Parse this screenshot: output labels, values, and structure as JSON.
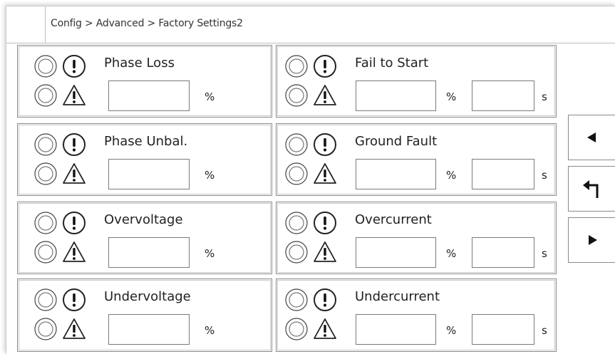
{
  "breadcrumb": "Config > Advanced > Factory Settings2",
  "left_panels": [
    {
      "title": "Phase Loss",
      "unit": "%"
    },
    {
      "title": "Phase Unbal.",
      "unit": "%"
    },
    {
      "title": "Overvoltage",
      "unit": "%"
    },
    {
      "title": "Undervoltage",
      "unit": "%"
    }
  ],
  "right_panels": [
    {
      "title": "Fail to Start",
      "unit1": "%",
      "unit2": "s"
    },
    {
      "title": "Ground Fault",
      "unit1": "%",
      "unit2": "s"
    },
    {
      "title": "Overcurrent",
      "unit1": "%",
      "unit2": "s"
    },
    {
      "title": "Undercurrent",
      "unit1": "%",
      "unit2": "s"
    }
  ],
  "nav": {
    "prev_icon": "triangle-left-icon",
    "back_icon": "return-arrow-icon",
    "next_icon": "triangle-right-icon"
  }
}
